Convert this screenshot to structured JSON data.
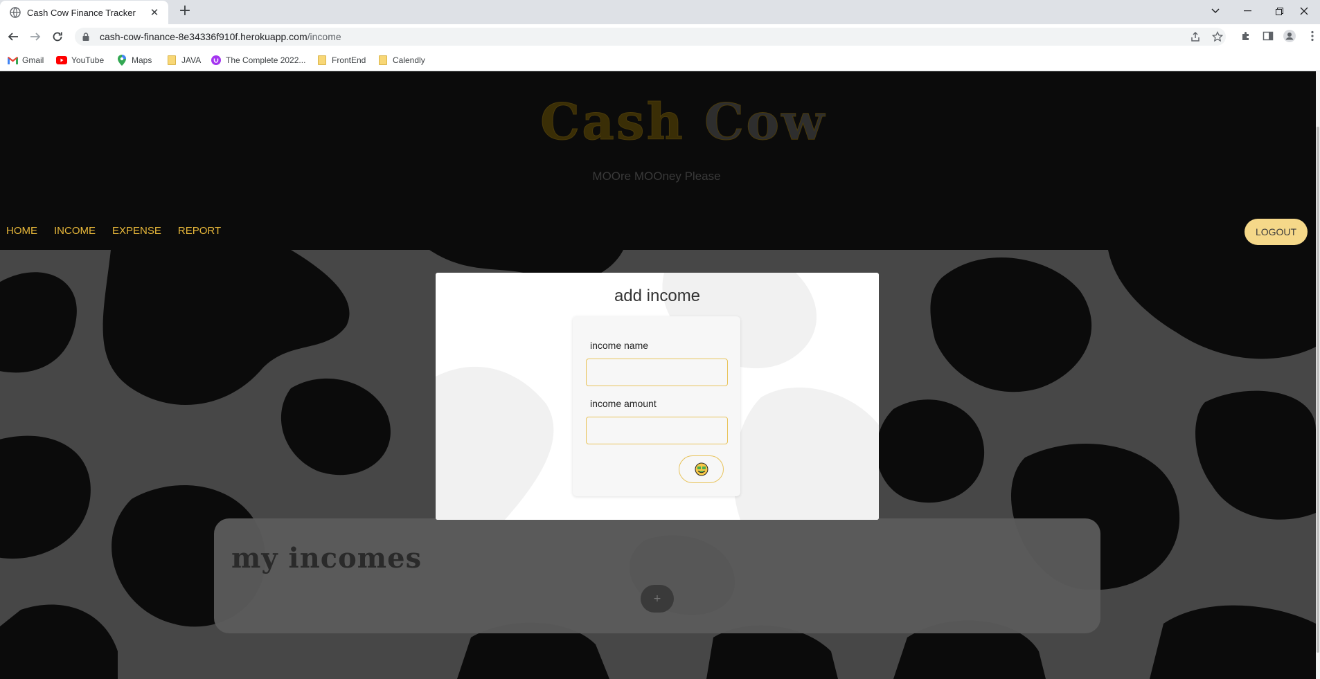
{
  "browser": {
    "tab_title": "Cash Cow Finance Tracker",
    "url_host": "cash-cow-finance-8e34336f910f.herokuapp.com",
    "url_path": "/income",
    "bookmarks": [
      {
        "label": "Gmail",
        "icon": "gmail-icon"
      },
      {
        "label": "YouTube",
        "icon": "youtube-icon"
      },
      {
        "label": "Maps",
        "icon": "maps-icon"
      },
      {
        "label": "JAVA",
        "icon": "folder-icon"
      },
      {
        "label": "The Complete 2022...",
        "icon": "udemy-icon"
      },
      {
        "label": "FrontEnd",
        "icon": "folder-icon"
      },
      {
        "label": "Calendly",
        "icon": "folder-icon"
      }
    ]
  },
  "header": {
    "logo_part1": "Cash",
    "logo_part2": "Cow",
    "tagline": "MOOre MOOney Please"
  },
  "nav": {
    "items": [
      "HOME",
      "INCOME",
      "EXPENSE",
      "REPORT"
    ],
    "logout_label": "LOGOUT"
  },
  "modal": {
    "title": "add income",
    "name_label": "income name",
    "name_value": "",
    "amount_label": "income amount",
    "amount_value": "",
    "submit_icon": "money-face-icon"
  },
  "incomes": {
    "title": "my incomes",
    "add_label": "+"
  },
  "colors": {
    "accent_gold": "#e8b83a",
    "logout_bg": "#f5d889",
    "page_bg": "#0b0b0b",
    "cow_light": "#474747"
  }
}
